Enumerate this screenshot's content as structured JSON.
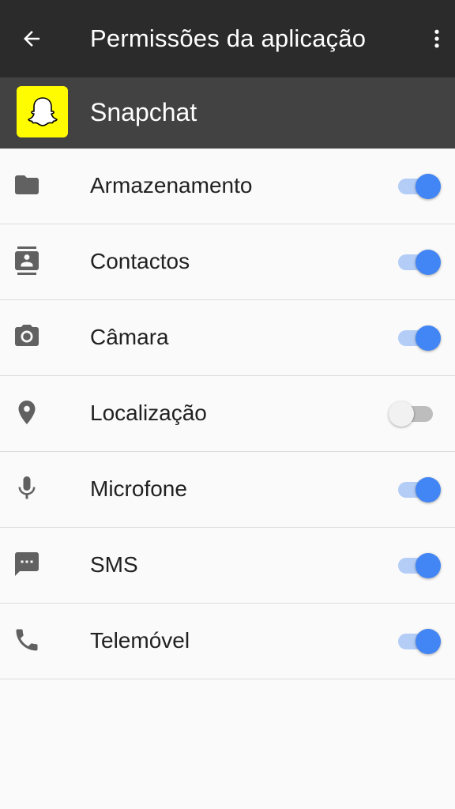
{
  "appbar": {
    "title": "Permissões da aplicação",
    "back_icon": "arrow-back-icon",
    "menu_icon": "more-vertical-icon",
    "background": "#2b2b2b"
  },
  "app": {
    "name": "Snapchat",
    "icon": "snapchat-ghost-icon",
    "icon_color": "#fffc00"
  },
  "permissions": [
    {
      "label": "Armazenamento",
      "icon": "folder-icon",
      "enabled": true
    },
    {
      "label": "Contactos",
      "icon": "contacts-icon",
      "enabled": true
    },
    {
      "label": "Câmara",
      "icon": "camera-icon",
      "enabled": true
    },
    {
      "label": "Localização",
      "icon": "location-pin-icon",
      "enabled": false
    },
    {
      "label": "Microfone",
      "icon": "microphone-icon",
      "enabled": true
    },
    {
      "label": "SMS",
      "icon": "sms-icon",
      "enabled": true
    },
    {
      "label": "Telemóvel",
      "icon": "phone-icon",
      "enabled": true
    }
  ],
  "colors": {
    "toggle_on": "#4285f4",
    "toggle_off": "#f1f1f1"
  }
}
